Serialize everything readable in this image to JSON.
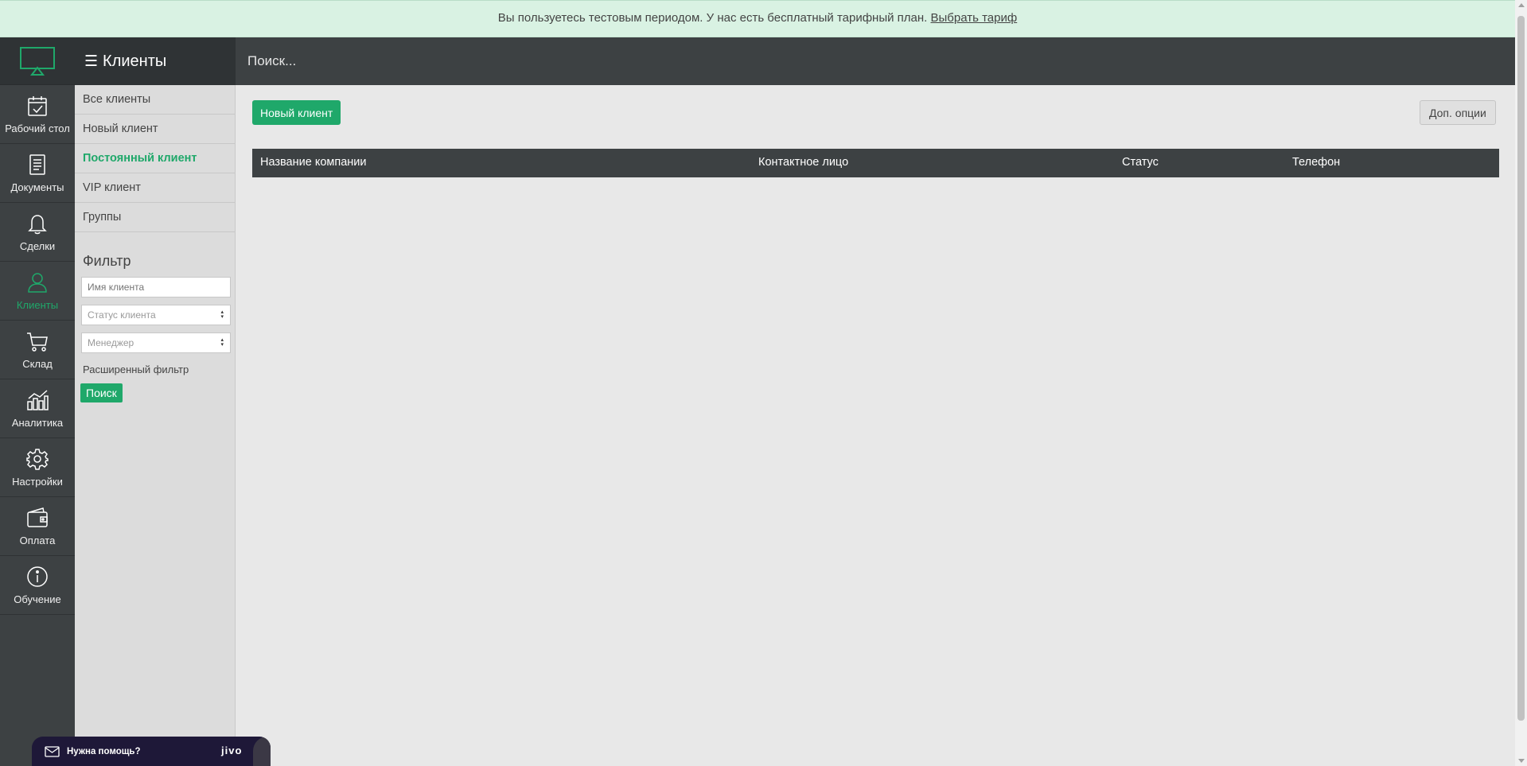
{
  "banner": {
    "text": "Вы пользуетесь тестовым периодом. У нас есть бесплатный тарифный план.",
    "link": "Выбрать тариф"
  },
  "module": {
    "title": "Клиенты"
  },
  "search": {
    "placeholder": "Поиск..."
  },
  "nav": [
    {
      "label": "Рабочий стол",
      "icon": "calendar-check-icon"
    },
    {
      "label": "Документы",
      "icon": "document-icon"
    },
    {
      "label": "Сделки",
      "icon": "bell-icon"
    },
    {
      "label": "Клиенты",
      "icon": "user-icon",
      "active": true
    },
    {
      "label": "Склад",
      "icon": "cart-icon"
    },
    {
      "label": "Аналитика",
      "icon": "bar-chart-icon"
    },
    {
      "label": "Настройки",
      "icon": "gear-icon"
    },
    {
      "label": "Оплата",
      "icon": "wallet-icon"
    },
    {
      "label": "Обучение",
      "icon": "info-icon"
    }
  ],
  "subnav": [
    {
      "label": "Все клиенты"
    },
    {
      "label": "Новый клиент"
    },
    {
      "label": "Постоянный клиент",
      "active": true
    },
    {
      "label": "VIP клиент"
    },
    {
      "label": "Группы"
    }
  ],
  "filter": {
    "title": "Фильтр",
    "name_placeholder": "Имя клиента",
    "status_select": "Статус клиента",
    "manager_select": "Менеджер",
    "advanced": "Расширенный фильтр",
    "search_button": "Поиск"
  },
  "toolbar": {
    "new_client": "Новый клиент",
    "more_options": "Доп. опции"
  },
  "table": {
    "columns": [
      "Название компании",
      "Контактное лицо",
      "Статус",
      "Телефон"
    ]
  },
  "chat": {
    "label": "Нужна помощь?",
    "brand": "jivo"
  },
  "colors": {
    "accent": "#1fa86a",
    "dark": "#3d4143",
    "banner": "#d9f2e3"
  }
}
